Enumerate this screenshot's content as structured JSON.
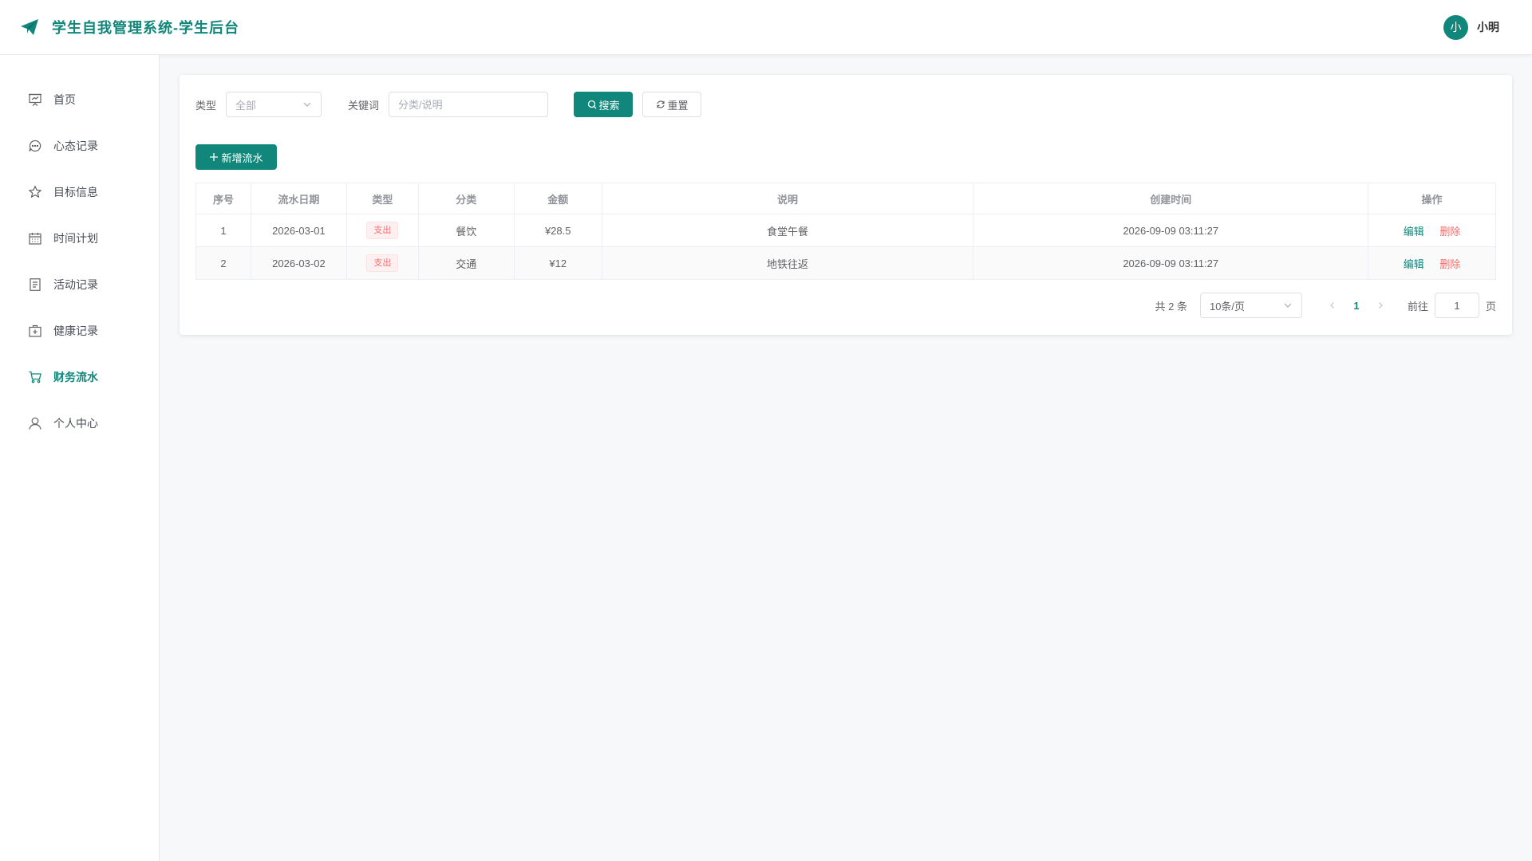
{
  "header": {
    "title": "学生自我管理系统-学生后台",
    "brand_color": "#11877c",
    "user": {
      "avatar_text": "小",
      "name": "小明"
    }
  },
  "sidebar": {
    "items": [
      {
        "label": "首页",
        "icon": "presentation-icon",
        "active": false
      },
      {
        "label": "心态记录",
        "icon": "chat-icon",
        "active": false
      },
      {
        "label": "目标信息",
        "icon": "star-icon",
        "active": false
      },
      {
        "label": "时间计划",
        "icon": "calendar-icon",
        "active": false
      },
      {
        "label": "活动记录",
        "icon": "document-icon",
        "active": false
      },
      {
        "label": "健康记录",
        "icon": "first-aid-icon",
        "active": false
      },
      {
        "label": "财务流水",
        "icon": "cart-icon",
        "active": true
      },
      {
        "label": "个人中心",
        "icon": "user-icon",
        "active": false
      }
    ]
  },
  "filters": {
    "type_label": "类型",
    "type_value": "全部",
    "keyword_label": "关键词",
    "keyword_placeholder": "分类/说明",
    "keyword_value": "",
    "search_label": "搜索",
    "reset_label": "重置"
  },
  "toolbar": {
    "add_label": "新增流水"
  },
  "table": {
    "columns": [
      "序号",
      "流水日期",
      "类型",
      "分类",
      "金额",
      "说明",
      "创建时间",
      "操作"
    ],
    "rows": [
      {
        "index": "1",
        "date": "2026-03-01",
        "type": "支出",
        "category": "餐饮",
        "amount": "¥28.5",
        "note": "食堂午餐",
        "created": "2026-09-09 03:11:27"
      },
      {
        "index": "2",
        "date": "2026-03-02",
        "type": "支出",
        "category": "交通",
        "amount": "¥12",
        "note": "地铁往返",
        "created": "2026-09-09 03:11:27"
      }
    ],
    "edit_label": "编辑",
    "delete_label": "删除",
    "expense_color": "#f56c6c"
  },
  "pagination": {
    "total_text": "共 2 条",
    "page_size": "10条/页",
    "current_page": "1",
    "goto_label": "前往",
    "goto_value": "1",
    "goto_suffix": "页"
  }
}
